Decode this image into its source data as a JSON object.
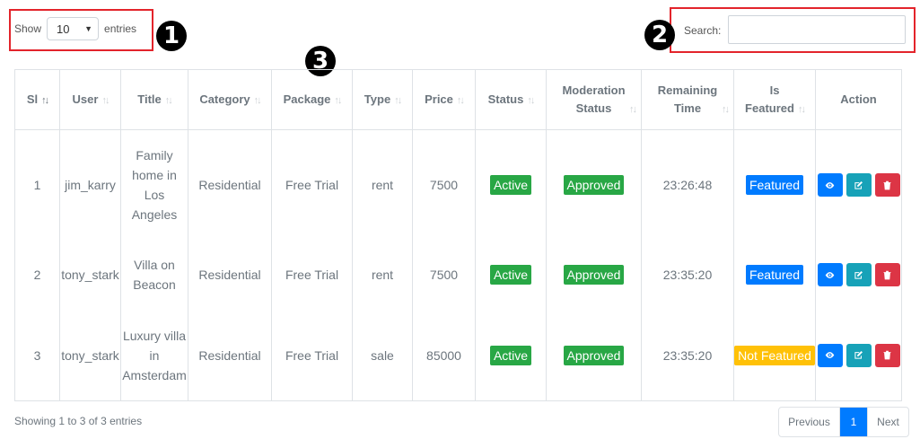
{
  "length": {
    "show": "Show",
    "value": "10",
    "entries": "entries"
  },
  "search": {
    "label": "Search:",
    "value": ""
  },
  "markers": [
    "1",
    "2",
    "3"
  ],
  "table": {
    "headers": {
      "sl": "Sl",
      "user": "User",
      "title": "Title",
      "category": "Category",
      "package": "Package",
      "type": "Type",
      "price": "Price",
      "status": "Status",
      "moderation_1": "Moderation",
      "moderation_2": "Status",
      "remaining_1": "Remaining",
      "remaining_2": "Time",
      "featured_1": "Is",
      "featured_2": "Featured",
      "action": "Action"
    },
    "rows": [
      {
        "sl": "1",
        "user": "jim_karry",
        "title_lines": [
          "Family",
          "home in",
          "Los",
          "Angeles"
        ],
        "category": "Residential",
        "package": "Free Trial",
        "type": "rent",
        "price": "7500",
        "status": "Active",
        "moderation": "Approved",
        "remaining": "23:26:48",
        "featured": "Featured"
      },
      {
        "sl": "2",
        "user": "tony_stark",
        "title_lines": [
          "Villa on",
          "Beacon"
        ],
        "category": "Residential",
        "package": "Free Trial",
        "type": "rent",
        "price": "7500",
        "status": "Active",
        "moderation": "Approved",
        "remaining": "23:35:20",
        "featured": "Featured"
      },
      {
        "sl": "3",
        "user": "tony_stark",
        "title_lines": [
          "Luxury villa",
          "in",
          "Amsterdam"
        ],
        "category": "Residential",
        "package": "Free Trial",
        "type": "sale",
        "price": "85000",
        "status": "Active",
        "moderation": "Approved",
        "remaining": "23:35:20",
        "featured": "Not Featured"
      }
    ]
  },
  "info": "Showing 1 to 3 of 3 entries",
  "pager": {
    "previous": "Previous",
    "current": "1",
    "next": "Next"
  },
  "colors": {
    "primary": "#007bff",
    "success": "#28a745",
    "info": "#17a2b8",
    "danger": "#dc3545",
    "warning": "#ffc107",
    "callout": "#e3242b"
  },
  "icons": {
    "view": "eye-icon",
    "edit": "edit-icon",
    "delete": "trash-icon",
    "sort": "sort-icon"
  }
}
